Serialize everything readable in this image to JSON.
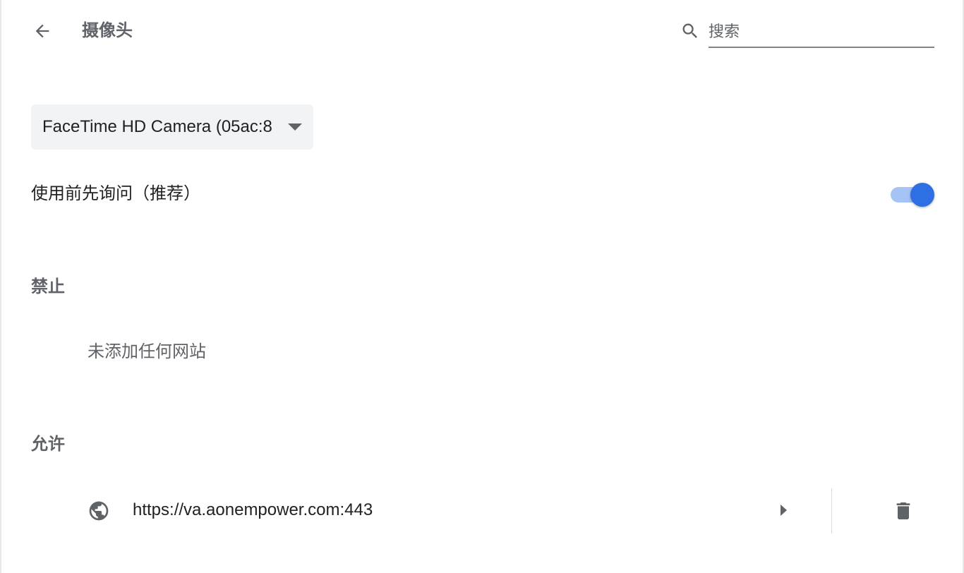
{
  "header": {
    "title": "摄像头",
    "search_placeholder": "搜索",
    "search_value": ""
  },
  "camera_select": {
    "selected": "FaceTime HD Camera (05ac:8"
  },
  "ask_before_access": {
    "label": "使用前先询问（推荐）",
    "enabled": true
  },
  "blocked": {
    "heading": "禁止",
    "empty_text": "未添加任何网站"
  },
  "allowed": {
    "heading": "允许",
    "sites": [
      {
        "url": "https://va.aonempower.com:443",
        "icon": "globe-icon"
      }
    ]
  },
  "colors": {
    "accent": "#2f6fe4",
    "toggle_track": "#a6c3f6",
    "secondary_text": "#5f6368",
    "primary_text": "#202124"
  }
}
